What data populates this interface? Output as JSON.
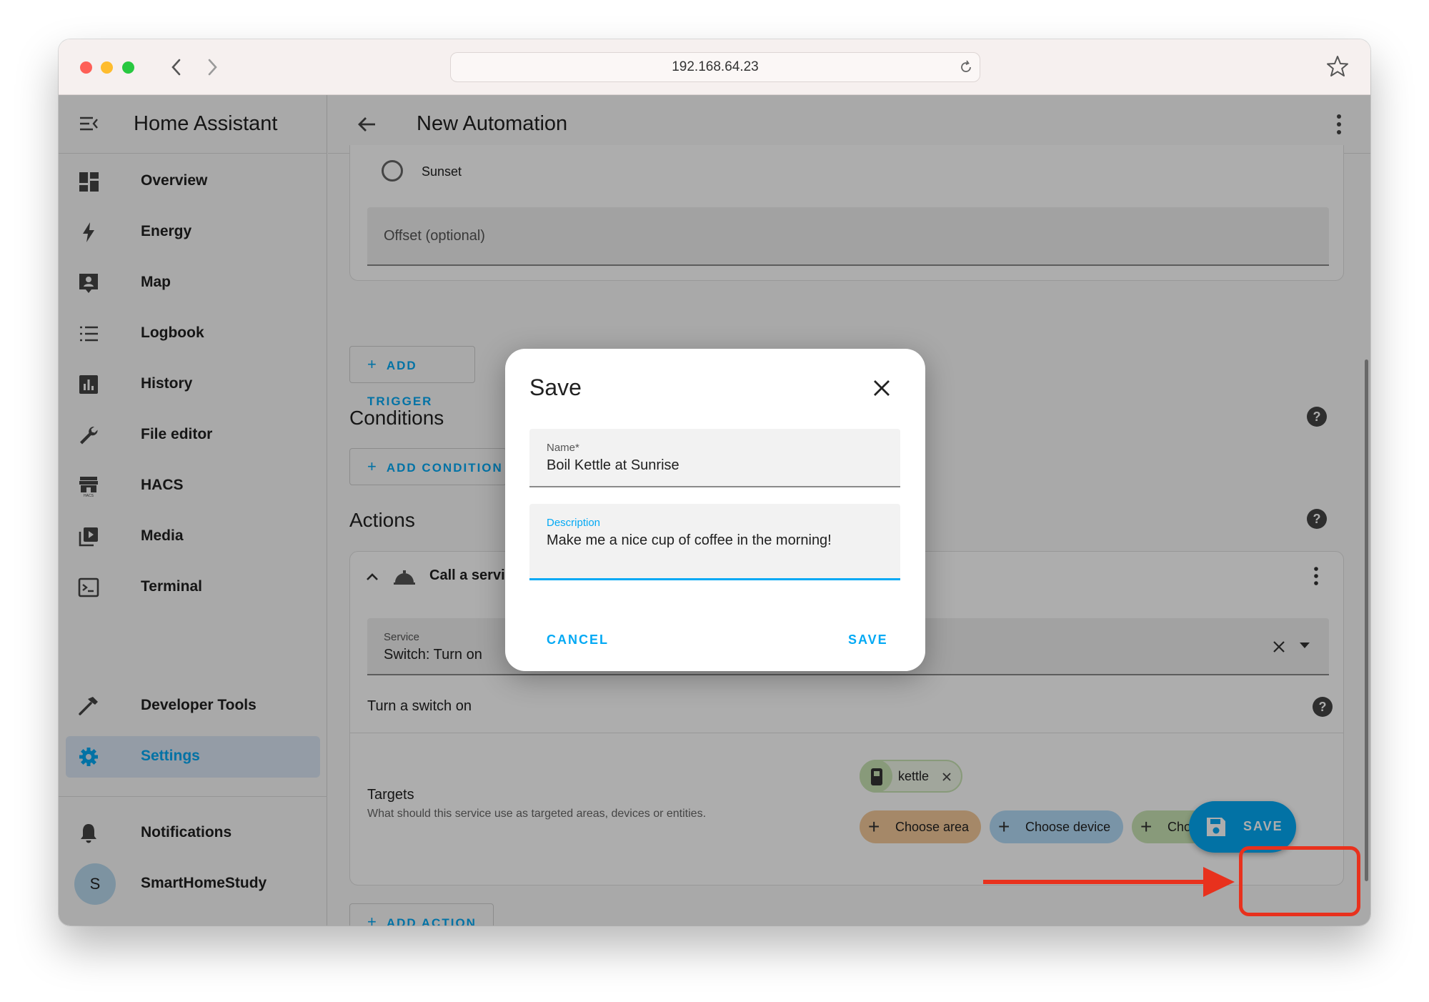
{
  "browser": {
    "url": "192.168.64.23"
  },
  "sidebar": {
    "title": "Home Assistant",
    "items": [
      {
        "label": "Overview",
        "icon": "dashboard-icon"
      },
      {
        "label": "Energy",
        "icon": "lightning-icon"
      },
      {
        "label": "Map",
        "icon": "map-person-icon"
      },
      {
        "label": "Logbook",
        "icon": "list-icon"
      },
      {
        "label": "History",
        "icon": "bar-chart-icon"
      },
      {
        "label": "File editor",
        "icon": "wrench-icon"
      },
      {
        "label": "HACS",
        "icon": "hacs-store-icon"
      },
      {
        "label": "Media",
        "icon": "media-play-icon"
      },
      {
        "label": "Terminal",
        "icon": "terminal-icon"
      }
    ],
    "developer_tools": "Developer Tools",
    "settings": "Settings",
    "notifications": "Notifications",
    "user_initial": "S",
    "user_name": "SmartHomeStudy"
  },
  "header": {
    "title": "New Automation"
  },
  "trigger": {
    "sunset_label": "Sunset",
    "offset_placeholder": "Offset (optional)",
    "add_trigger": "ADD TRIGGER"
  },
  "conditions": {
    "title": "Conditions",
    "add_condition": "ADD CONDITION"
  },
  "actions": {
    "title": "Actions",
    "action_title": "Call a servi",
    "service_label": "Service",
    "service_value": "Switch: Turn on",
    "service_description": "Turn a switch on",
    "targets_title": "Targets",
    "targets_description": "What should this service use as targeted areas, devices or entities.",
    "target_chip": "kettle",
    "choose_area": "Choose area",
    "choose_device": "Choose device",
    "choose_entity": "Choose entity",
    "add_action": "ADD ACTION"
  },
  "fab": {
    "label": "SAVE"
  },
  "dialog": {
    "title": "Save",
    "name_label": "Name*",
    "name_value": "Boil Kettle at Sunrise",
    "description_label": "Description",
    "description_value": "Make me a nice cup of coffee in the morning!",
    "cancel": "CANCEL",
    "save": "SAVE"
  },
  "colors": {
    "accent": "#03a9f4",
    "annotation": "#e8311d",
    "area_chip": "#f4c99a",
    "device_chip": "#b3daf7",
    "entity_chip": "#c9e4b4"
  }
}
